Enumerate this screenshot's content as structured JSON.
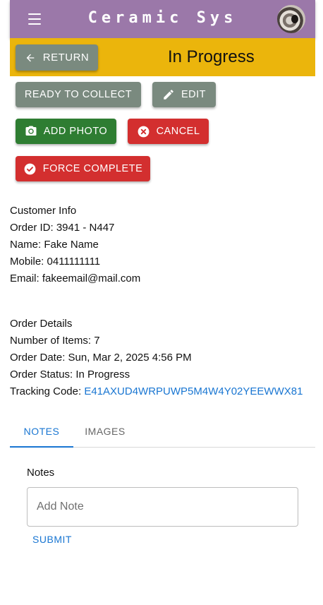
{
  "appbar": {
    "title": "Ceramic Sys",
    "menu_icon": "hamburger-menu-icon",
    "avatar_icon": "user-avatar",
    "color": "#9b78a9"
  },
  "status": {
    "return_label": "RETURN",
    "title": "In Progress",
    "color": "#ebb50c"
  },
  "actions": {
    "ready_label": "READY TO COLLECT",
    "edit_label": "EDIT",
    "add_photo_label": "ADD PHOTO",
    "cancel_label": "CANCEL",
    "force_complete_label": "FORCE COMPLETE"
  },
  "customer": {
    "heading": "Customer Info",
    "order_id": "Order ID: 3941 - N447",
    "name": "Name: Fake Name",
    "mobile": "Mobile: 0411111111",
    "email": "Email: fakeemail@mail.com"
  },
  "order": {
    "heading": "Order Details",
    "items": "Number of Items: 7",
    "date": "Order Date: Sun, Mar 2, 2025 4:56 PM",
    "status": "Order Status: In Progress",
    "tracking_label": "Tracking Code: ",
    "tracking_code": "E41AXUD4WRPUWP5M4W4Y02YEEWWX81"
  },
  "tabs": {
    "notes": "NOTES",
    "images": "IMAGES",
    "active": "NOTES"
  },
  "notes": {
    "label": "Notes",
    "input_value": "",
    "placeholder": "Add Note",
    "submit_label": "SUBMIT"
  },
  "colors": {
    "grey_button": "#7a8a7f",
    "green_button": "#2e7d32",
    "red_button": "#d32f2f",
    "link_blue": "#1976d2"
  }
}
